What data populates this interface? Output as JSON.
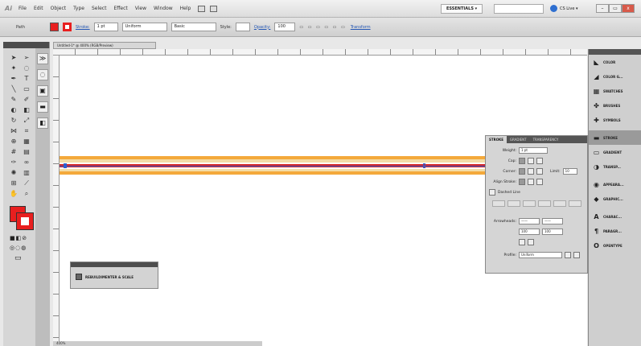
{
  "app": {
    "logo": "Ai"
  },
  "menu": [
    "File",
    "Edit",
    "Object",
    "Type",
    "Select",
    "Effect",
    "View",
    "Window",
    "Help"
  ],
  "topbar": {
    "workspace": "ESSENTIALS ▾",
    "cslive": "CS Live ▾",
    "win_btns": [
      "–",
      "▭",
      "x"
    ]
  },
  "control": {
    "label": "Path",
    "stroke_label": "Stroke:",
    "stroke_weight": "1 pt",
    "profile": "Uniform",
    "brush": "Basic",
    "style_label": "Style:",
    "opacity_label": "Opacity:",
    "opacity": "100",
    "transform_link": "Transform"
  },
  "document": {
    "tab": "Untitled-1* @ 400% (RGB/Preview)",
    "status": "400%"
  },
  "rebuild_panel": {
    "label": "REBUILDIMENTER & SCALE"
  },
  "stroke_panel": {
    "tabs": [
      "STROKE",
      "GRADIENT",
      "TRANSPARENCY"
    ],
    "rows": [
      {
        "label": "Weight:",
        "value": "1 pt"
      },
      {
        "label": "Cap:"
      },
      {
        "label": "Corner:",
        "extra": "Limit:",
        "extra_value": "10"
      },
      {
        "label": "Align Stroke:"
      }
    ],
    "dashed": "Dashed Line",
    "arrowheads": "Arrowheads:",
    "scale1": "100",
    "scale2": "100",
    "profile_label": "Profile:",
    "profile_value": "Uniform"
  },
  "right_dock": [
    {
      "icon": "color-icon",
      "glyph": "◣",
      "label": "COLOR"
    },
    {
      "icon": "color-guide-icon",
      "glyph": "◢",
      "label": "COLOR G..."
    },
    {
      "icon": "swatches-icon",
      "glyph": "▦",
      "label": "SWATCHES"
    },
    {
      "icon": "brushes-icon",
      "glyph": "✤",
      "label": "BRUSHES"
    },
    {
      "icon": "symbols-icon",
      "glyph": "✚",
      "label": "SYMBOLS"
    },
    {
      "icon": "stroke-icon",
      "glyph": "▬",
      "label": "STROKE"
    },
    {
      "icon": "gradient-icon",
      "glyph": "▭",
      "label": "GRADIENT"
    },
    {
      "icon": "transparency-icon",
      "glyph": "◑",
      "label": "TRANSP..."
    },
    {
      "icon": "appearance-icon",
      "glyph": "◉",
      "label": "APPEARA..."
    },
    {
      "icon": "graphic-styles-icon",
      "glyph": "◆",
      "label": "GRAPHIC..."
    },
    {
      "icon": "character-icon",
      "glyph": "A",
      "label": "CHARAC..."
    },
    {
      "icon": "paragraph-icon",
      "glyph": "¶",
      "label": "PARAGR..."
    },
    {
      "icon": "opentype-icon",
      "glyph": "O",
      "label": "OPENTYPE"
    }
  ],
  "colors": {
    "fill": "#e81f1f",
    "stroke_outer": "#f4a93b",
    "stroke_inner": "#d62020"
  }
}
